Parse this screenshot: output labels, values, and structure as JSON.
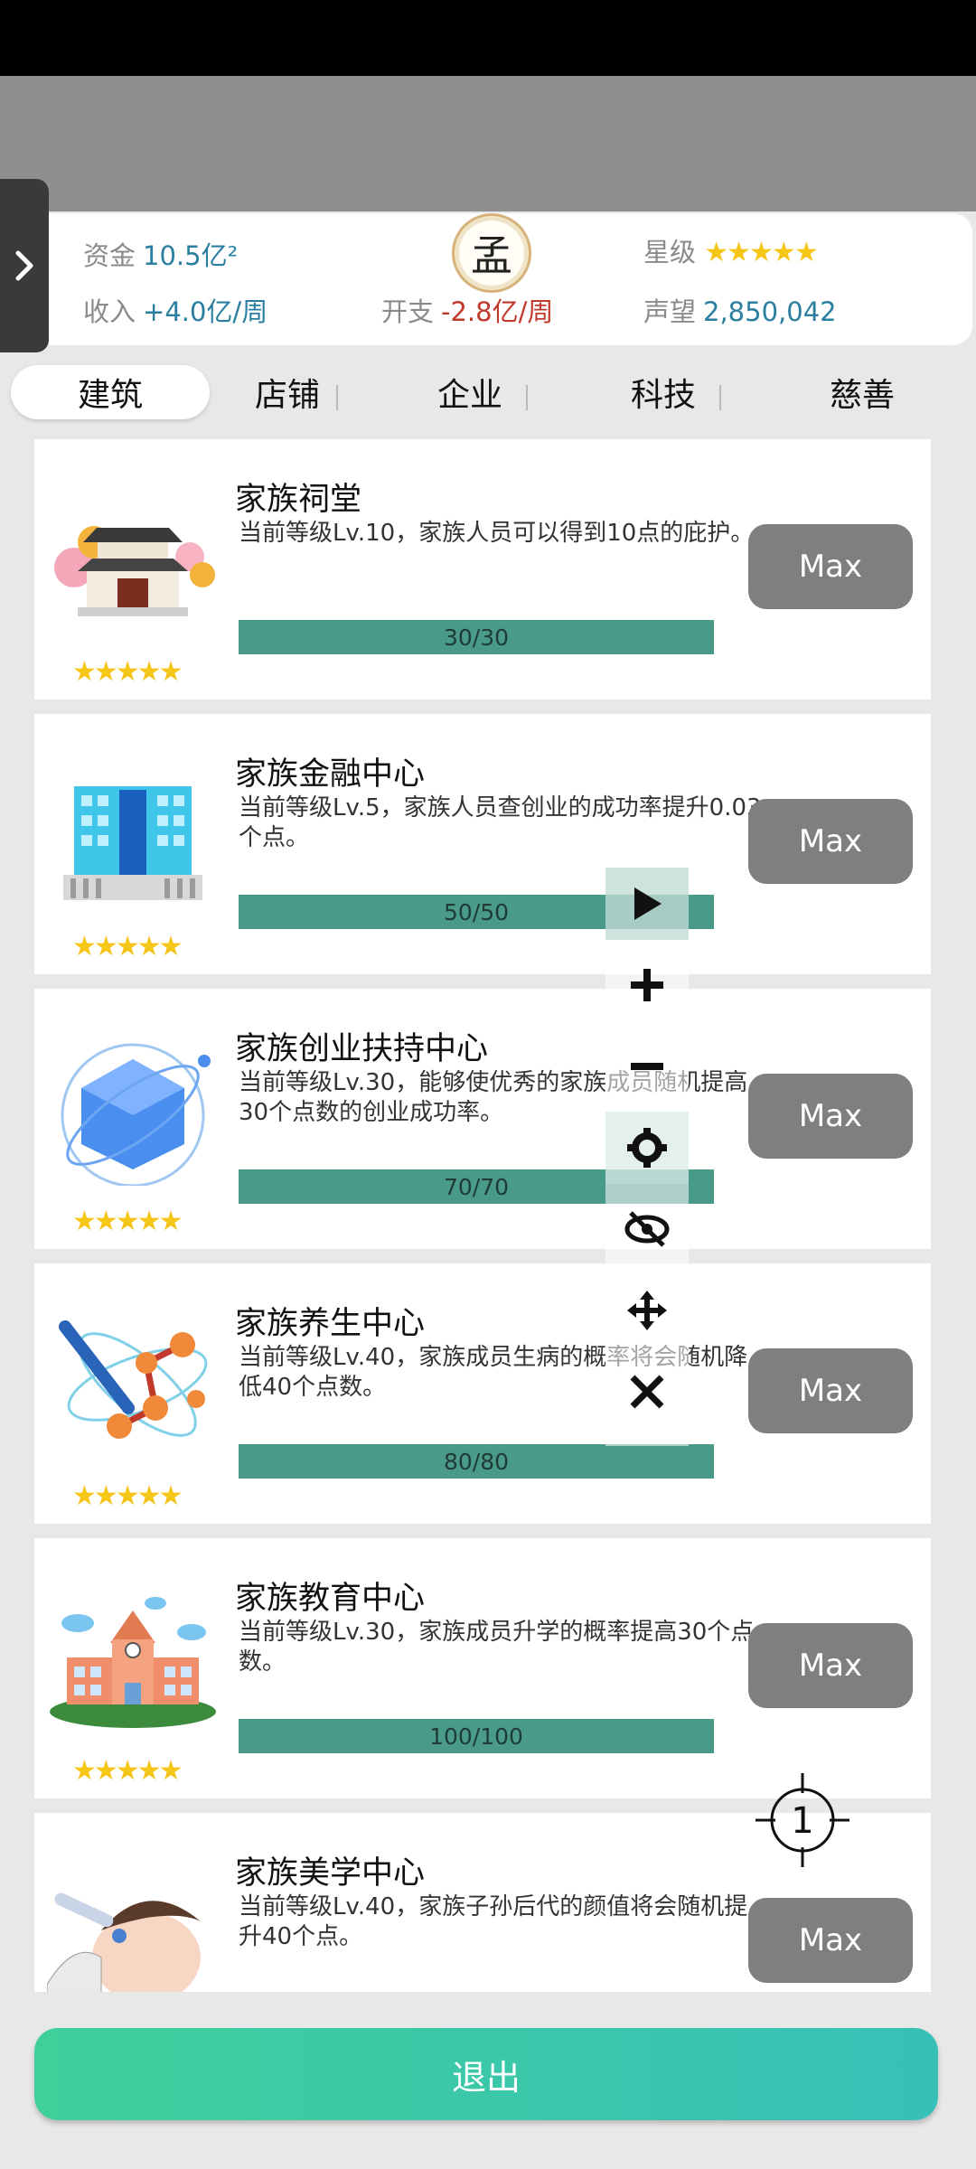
{
  "stats": {
    "funds_label": "资金",
    "funds_value": "10.5亿²",
    "income_label": "收入",
    "income_value": "+4.0亿/周",
    "expense_label": "开支",
    "expense_value": "-2.8亿/周",
    "rank_label": "星级",
    "rank_stars": "★★★★★",
    "reputation_label": "声望",
    "reputation_value": "2,850,042",
    "family_crest": "孟"
  },
  "tabs": [
    "建筑",
    "店铺",
    "企业",
    "科技",
    "慈善"
  ],
  "buildings": [
    {
      "title": "家族祠堂",
      "desc": "当前等级Lv.10，家族人员可以得到10点的庇护。",
      "progress": "30/30",
      "button": "Max",
      "stars": "★★★★★"
    },
    {
      "title": "家族金融中心",
      "desc": "当前等级Lv.5，家族人员查创业的成功率提升0.03个点。",
      "progress": "50/50",
      "button": "Max",
      "stars": "★★★★★"
    },
    {
      "title": "家族创业扶持中心",
      "desc": "当前等级Lv.30，能够使优秀的家族成员随机提高30个点数的创业成功率。",
      "progress": "70/70",
      "button": "Max",
      "stars": "★★★★★"
    },
    {
      "title": "家族养生中心",
      "desc": "当前等级Lv.40，家族成员生病的概率将会随机降低40个点数。",
      "progress": "80/80",
      "button": "Max",
      "stars": "★★★★★"
    },
    {
      "title": "家族教育中心",
      "desc": "当前等级Lv.30，家族成员升学的概率提高30个点数。",
      "progress": "100/100",
      "button": "Max",
      "stars": "★★★★★"
    },
    {
      "title": "家族美学中心",
      "desc": "当前等级Lv.40，家族子孙后代的颜值将会随机提升40个点。",
      "progress": "",
      "button": "Max",
      "stars": ""
    }
  ],
  "crosshair_label": "1",
  "exit_label": "退出"
}
